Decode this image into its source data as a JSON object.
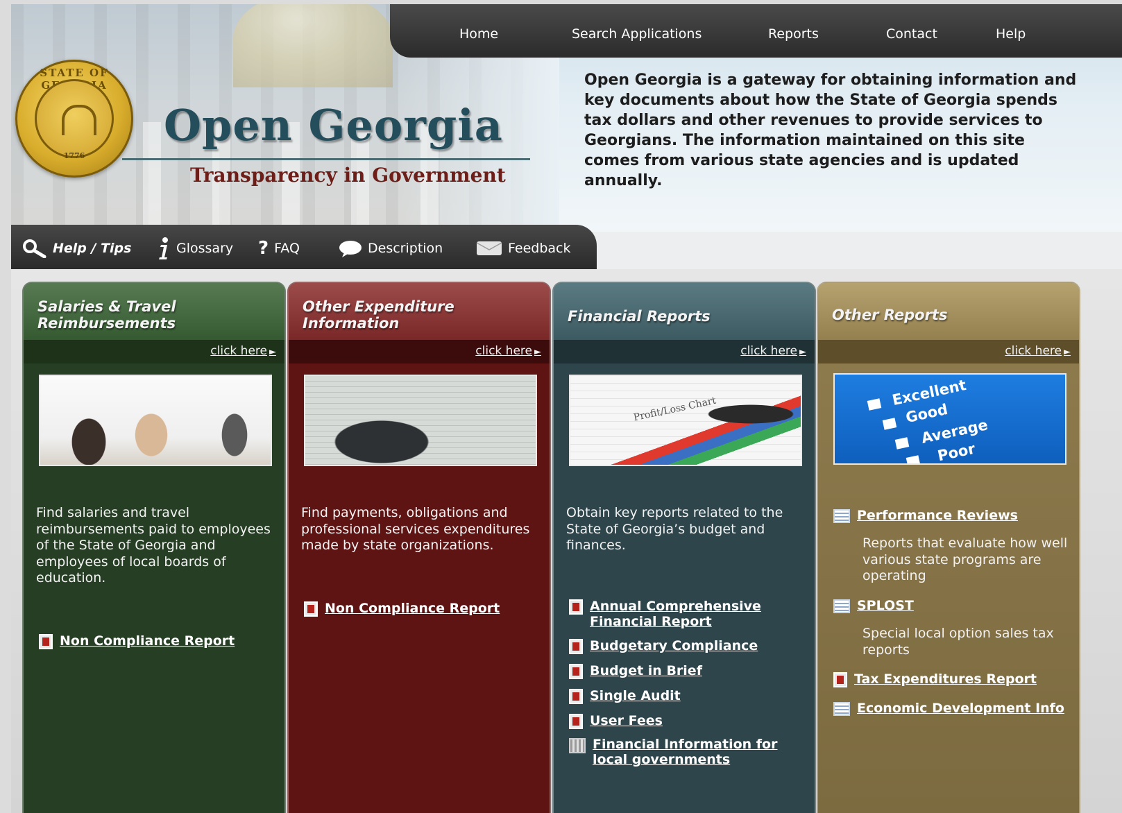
{
  "site": {
    "seal_text": "STATE OF GEORGIA",
    "seal_year": "1776",
    "title": "Open Georgia",
    "subtitle": "Transparency in Government",
    "intro": "Open Georgia is a gateway for obtaining information and key documents about how the State of Georgia spends tax dollars and other revenues to provide services to Georgians. The information maintained on this site comes from various state agencies and is updated annually."
  },
  "topnav": {
    "items": [
      {
        "label": "Home"
      },
      {
        "label": "Search Applications"
      },
      {
        "label": "Reports"
      },
      {
        "label": "Contact"
      },
      {
        "label": "Help"
      }
    ]
  },
  "toolbar": {
    "items": [
      {
        "label": "Help / Tips",
        "icon": "magnifier-icon"
      },
      {
        "label": "Glossary",
        "icon": "info-icon"
      },
      {
        "label": "FAQ",
        "icon": "question-icon"
      },
      {
        "label": "Description",
        "icon": "speech-bubble-icon"
      },
      {
        "label": "Feedback",
        "icon": "envelope-icon"
      }
    ]
  },
  "panels": {
    "salaries": {
      "title": "Salaries & Travel Reimbursements",
      "click_here": "click here",
      "description": "Find salaries and travel reimbursements paid to employees of the State of Georgia and employees of local boards of education.",
      "links": [
        {
          "label": "Non Compliance Report",
          "icon": "pdf-icon"
        }
      ],
      "color": "#263e24"
    },
    "expenditure": {
      "title": "Other Expenditure Information",
      "click_here": "click here",
      "description": "Find payments, obligations and professional services expenditures made by state organizations.",
      "links": [
        {
          "label": "Non Compliance Report",
          "icon": "pdf-icon"
        }
      ],
      "color": "#5f1414"
    },
    "financial": {
      "title": "Financial Reports",
      "click_here": "click here",
      "photo_caption": "Profit/Loss Chart",
      "description": "Obtain key reports related to the State of Georgia’s budget and finances.",
      "links": [
        {
          "label": "Annual Comprehensive Financial Report",
          "icon": "pdf-icon"
        },
        {
          "label": "Budgetary Compliance",
          "icon": "pdf-icon"
        },
        {
          "label": "Budget in Brief",
          "icon": "pdf-icon"
        },
        {
          "label": "Single Audit",
          "icon": "pdf-icon"
        },
        {
          "label": "User Fees",
          "icon": "pdf-icon"
        },
        {
          "label": "Financial Information for local governments",
          "icon": "building-icon"
        }
      ],
      "color": "#2d454b"
    },
    "other": {
      "title": "Other Reports",
      "click_here": "click here",
      "photo_labels": [
        "Excellent",
        "Good",
        "Average",
        "Poor"
      ],
      "links": [
        {
          "label": "Performance Reviews",
          "icon": "document-list-icon",
          "sub": "Reports that evaluate how well various state programs are operating"
        },
        {
          "label": "SPLOST",
          "icon": "document-list-icon",
          "sub": "Special local option sales tax reports"
        },
        {
          "label": "Tax Expenditures Report",
          "icon": "pdf-icon"
        },
        {
          "label": "Economic Development Info",
          "icon": "document-list-icon"
        }
      ],
      "color": "#8f7c4e"
    }
  }
}
